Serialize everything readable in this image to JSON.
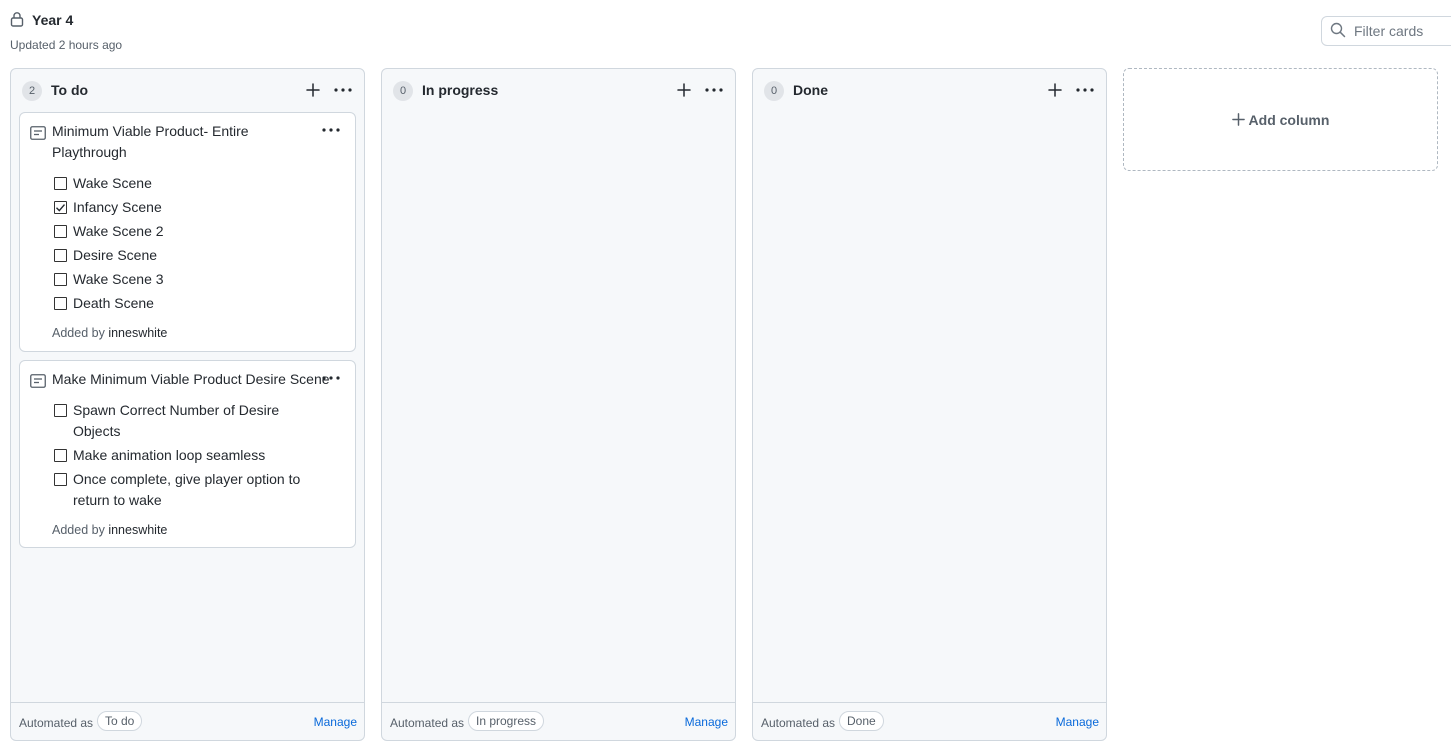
{
  "project": {
    "title": "Year 4",
    "updated": "Updated 2 hours ago"
  },
  "filter": {
    "placeholder": "Filter cards"
  },
  "columns": [
    {
      "count": "2",
      "name": "To do",
      "footer": {
        "label": "Automated as",
        "badge": "To do",
        "manage": "Manage"
      },
      "cards": [
        {
          "title": "Minimum Viable Product- Entire Playthrough",
          "tasks": [
            {
              "label": "Wake Scene",
              "checked": false
            },
            {
              "label": "Infancy Scene",
              "checked": true
            },
            {
              "label": "Wake Scene 2",
              "checked": false
            },
            {
              "label": "Desire Scene",
              "checked": false
            },
            {
              "label": "Wake Scene 3",
              "checked": false
            },
            {
              "label": "Death Scene",
              "checked": false
            }
          ],
          "added_prefix": "Added by",
          "added_user": "inneswhite"
        },
        {
          "title": "Make Minimum Viable Product Desire Scene",
          "tasks": [
            {
              "label": "Spawn Correct Number of Desire Objects",
              "checked": false
            },
            {
              "label": "Make animation loop seamless",
              "checked": false
            },
            {
              "label": "Once complete, give player option to return to wake",
              "checked": false
            }
          ],
          "added_prefix": "Added by",
          "added_user": "inneswhite"
        }
      ]
    },
    {
      "count": "0",
      "name": "In progress",
      "footer": {
        "label": "Automated as",
        "badge": "In progress",
        "manage": "Manage"
      },
      "cards": []
    },
    {
      "count": "0",
      "name": "Done",
      "footer": {
        "label": "Automated as",
        "badge": "Done",
        "manage": "Manage"
      },
      "cards": []
    }
  ],
  "add_column": {
    "label": "Add column"
  }
}
